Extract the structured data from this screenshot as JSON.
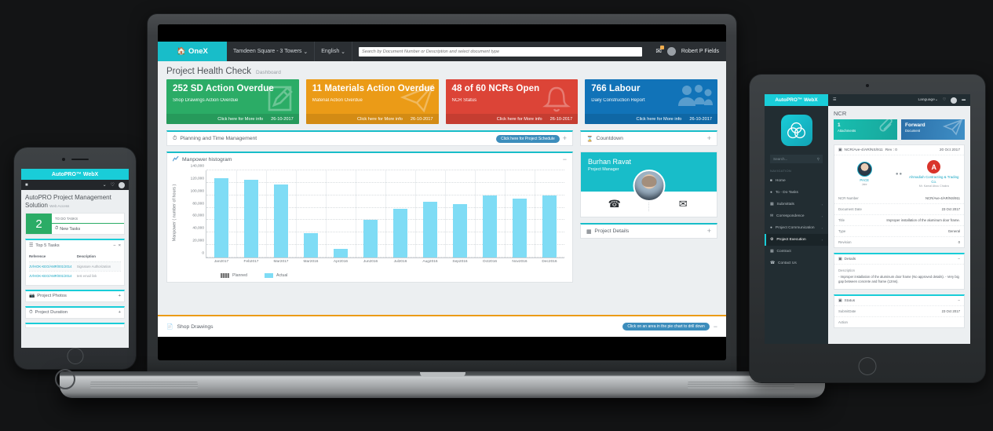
{
  "laptop": {
    "topbar": {
      "brand": "OneX",
      "project": "Tamdeen Square - 3 Towers",
      "language": "English",
      "search_placeholder": "Search by Document Number or Description and select document type",
      "user": "Robert P Fields"
    },
    "page": {
      "title": "Project Health Check",
      "subtitle": "Dashboard"
    },
    "kpis": [
      {
        "num": "252 SD Action Overdue",
        "sub": "Shop Drawings Action Overdue",
        "cta": "Click here for More info",
        "date": "26-10-2017",
        "color": "#2bac66",
        "icon": "pencil-icon"
      },
      {
        "num": "11 Materials Action Overdue",
        "sub": "Material Action Overdue",
        "cta": "Click here for More info",
        "date": "26-10-2017",
        "color": "#eb9b17",
        "icon": "paper-plane-icon"
      },
      {
        "num": "48 of 60 NCRs Open",
        "sub": "NCR Status",
        "cta": "Click here for More info",
        "date": "26-10-2017",
        "color": "#dc4437",
        "icon": "bell-icon"
      },
      {
        "num": "766 Labour",
        "sub": "Daily Construction Report",
        "cta": "Click here for More info",
        "date": "26-10-2017",
        "color": "#1173b8",
        "icon": "users-icon"
      }
    ],
    "planning": {
      "title": "Planning and Time Management",
      "button": "Click here for Project Schedule",
      "collapse": "+"
    },
    "chart_card": {
      "title": "Manpower histogram",
      "collapse": "−"
    },
    "countdown": {
      "title": "Countdown",
      "collapse": "+"
    },
    "profile": {
      "name": "Burhan Ravat",
      "role": "Project Manager",
      "phone_icon": "phone-icon",
      "mail_icon": "envelope-icon"
    },
    "project_details": {
      "title": "Project Details",
      "collapse": "+"
    },
    "bottombar": {
      "title": "Shop Drawings",
      "button": "Click on an area in the pie chart to drill down",
      "collapse": "−"
    }
  },
  "chart_data": {
    "type": "bar",
    "title": "Manpower histogram",
    "xlabel": "",
    "ylabel": "Manpower ( number of hours )",
    "categories": [
      "Jan2017",
      "Feb2017",
      "Mar2017",
      "Mar2016",
      "Apr2016",
      "Jun2016",
      "Jul2016",
      "Aug2016",
      "Sep2016",
      "Oct2016",
      "Nov2016",
      "Dec2016"
    ],
    "series": [
      {
        "name": "Planned",
        "color": "#777777",
        "values": [
          null,
          null,
          null,
          null,
          null,
          null,
          null,
          null,
          null,
          null,
          null,
          null
        ]
      },
      {
        "name": "Actual",
        "color": "#7fdcf5",
        "values": [
          128000,
          125500,
          117000,
          39000,
          14000,
          60500,
          78000,
          89000,
          86000,
          99500,
          94000,
          100000
        ]
      }
    ],
    "ylim": [
      0,
      140000
    ],
    "yticks": [
      0,
      20000,
      40000,
      60000,
      80000,
      100000,
      120000,
      140000
    ],
    "ytick_labels": [
      "0",
      "20,000",
      "40,000",
      "60,000",
      "80,000",
      "100,000",
      "120,000",
      "140,000"
    ],
    "grid": true,
    "legend_position": "bottom-left"
  },
  "phone": {
    "brand": "AutoPRO™ WebX",
    "title": "AutoPRO Project Management Solution",
    "title_sub": "Web Access",
    "todo": {
      "count": "2",
      "label": "TO DO TASKS",
      "item": "New Tasks"
    },
    "top_tasks": {
      "title": "Top 5 Tasks",
      "columns": [
        "Reference",
        "Description"
      ],
      "rows": [
        {
          "reference": "JV/HOK-KEO/AMR/001/2014",
          "description": "Signature Authorization"
        },
        {
          "reference": "JV/HOK-KEO/AMR/001/2014",
          "description": "test email link"
        }
      ]
    },
    "photos": {
      "title": "Project Photos",
      "collapse": "+"
    },
    "duration": {
      "title": "Project Duration",
      "collapse": "+"
    }
  },
  "tablet": {
    "brand": "AutoPRO™ WebX",
    "topbar": {
      "language": "Language",
      "heart_icon": "heart-icon",
      "menu_icon": "hamburger-icon"
    },
    "search_placeholder": "Search...",
    "nav_title": "NAVIGATION",
    "nav": [
      {
        "label": "Home",
        "icon": "home-icon",
        "caret": "",
        "active": false
      },
      {
        "label": "To - Do Tasks",
        "icon": "tasks-icon",
        "caret": "",
        "active": false
      },
      {
        "label": "Submittals",
        "icon": "submittals-icon",
        "caret": "›",
        "active": false
      },
      {
        "label": "Correspondence",
        "icon": "mail-icon",
        "caret": "›",
        "active": false
      },
      {
        "label": "Project Communication",
        "icon": "comm-icon",
        "caret": "›",
        "active": false
      },
      {
        "label": "Project Execution",
        "icon": "gear-icon",
        "caret": "›",
        "active": true
      },
      {
        "label": "Contract",
        "icon": "contract-icon",
        "caret": "",
        "active": false
      },
      {
        "label": "Contact Us",
        "icon": "phone-icon",
        "caret": "",
        "active": false
      }
    ],
    "page_title": "NCR",
    "tiles": [
      {
        "num": "1",
        "sub": "Attachments",
        "icon": "paperclip-icon"
      },
      {
        "num": "Forward",
        "sub": "Document",
        "icon": "paper-plane-icon"
      }
    ],
    "doc": {
      "ref": "NCR/Ave-4/AR/NS/911",
      "rev": "Rev : 0",
      "date": "20 Oct 2017"
    },
    "parties": {
      "left": {
        "name": "PACE",
        "sub": "Jabr"
      },
      "mid": "●●",
      "right": {
        "logo": "A",
        "name": "Ahmadiah Contracting & Trading Co.",
        "sub": "Mr. Kamal Abou Chakra"
      }
    },
    "fields": [
      {
        "key": "NCR Number",
        "value": "NCR/Ave-4/AR/NS/911"
      },
      {
        "key": "Document Date",
        "value": "23 Oct 2017"
      },
      {
        "key": "Title",
        "value": "Improper installation of the aluminum door frame."
      },
      {
        "key": "Type",
        "value": "General"
      },
      {
        "key": "Revision",
        "value": "0"
      }
    ],
    "details": {
      "title": "Details",
      "collapse": "−",
      "desc_label": "Description",
      "desc": "- Improper installation of the aluminum door frame (No approved details). - Very big gap between concrete and frame (12ms)."
    },
    "status": {
      "title": "Status",
      "collapse": "−",
      "rows": [
        {
          "key": "SubmitDate",
          "value": "23 Oct 2017"
        },
        {
          "key": "Action",
          "value": ""
        }
      ]
    }
  }
}
